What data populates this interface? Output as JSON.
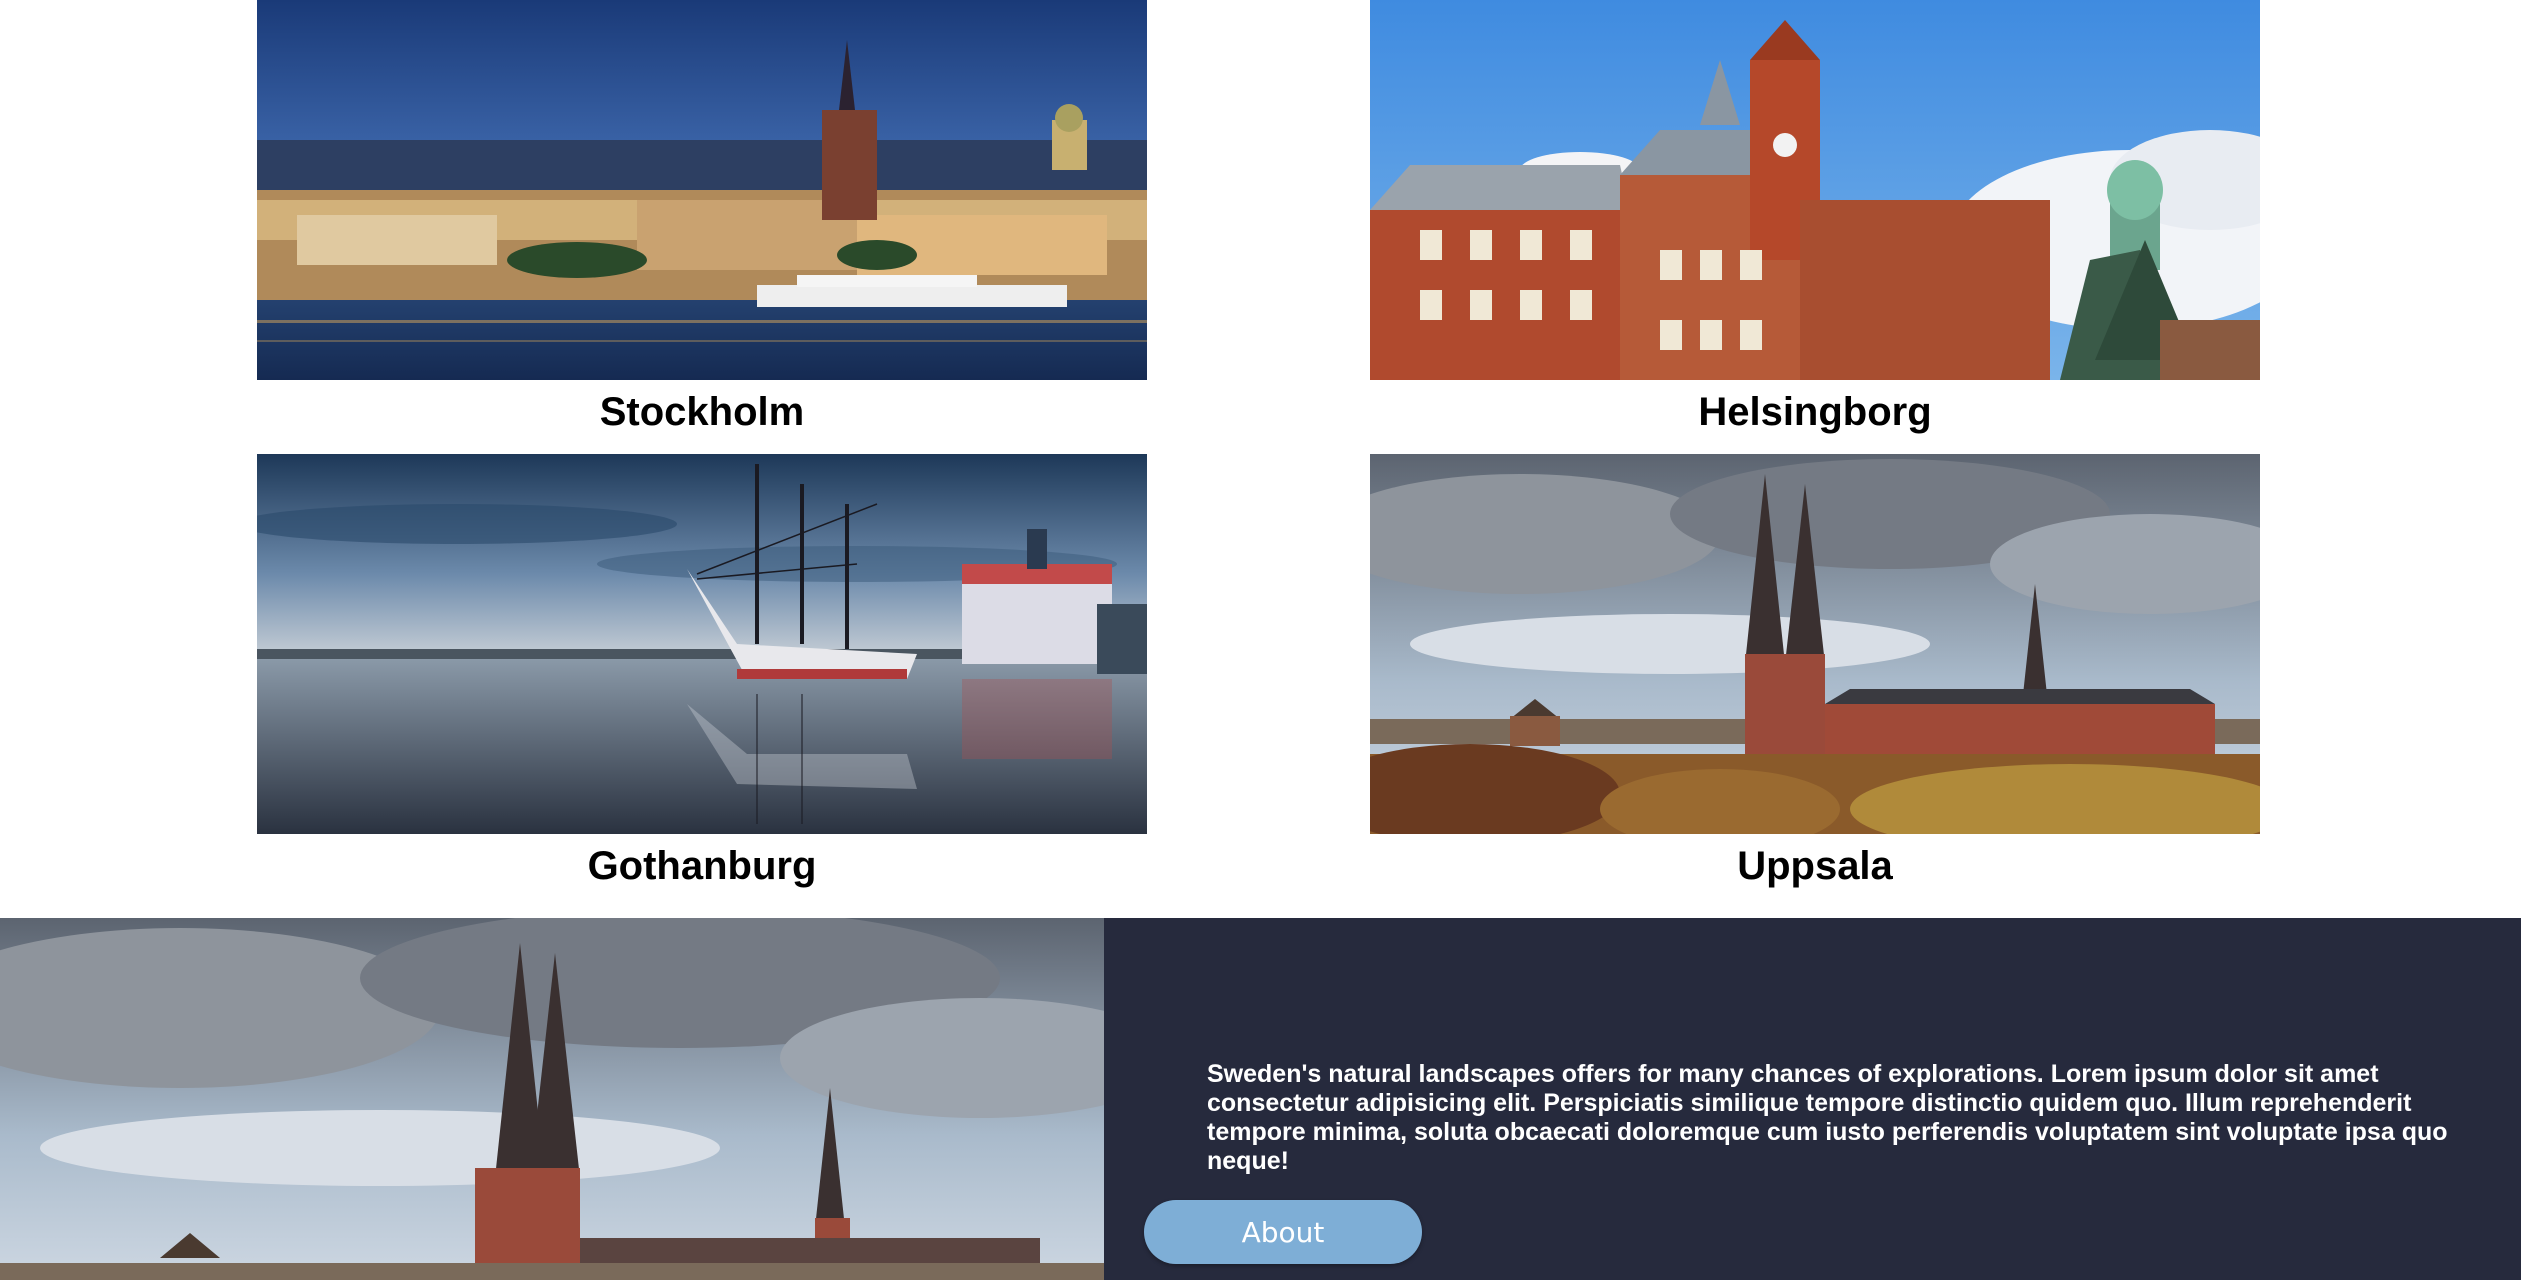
{
  "cities": [
    {
      "key": "stockholm",
      "name": "Stockholm"
    },
    {
      "key": "helsingborg",
      "name": "Helsingborg"
    },
    {
      "key": "gothenburg",
      "name": "Gothanburg"
    },
    {
      "key": "uppsala",
      "name": "Uppsala"
    }
  ],
  "about": {
    "text": "Sweden's natural landscapes offers for many chances of explorations. Lorem ipsum dolor sit amet consectetur adipisicing elit. Perspiciatis similique tempore distinctio quidem quo. Illum reprehenderit tempore minima, soluta obcaecati doloremque cum iusto perferendis voluptatem sint voluptate ipsa quo neque!",
    "button_label": "About"
  },
  "colors": {
    "bottom_background": "#262a3d",
    "button": "#7eaed6"
  }
}
